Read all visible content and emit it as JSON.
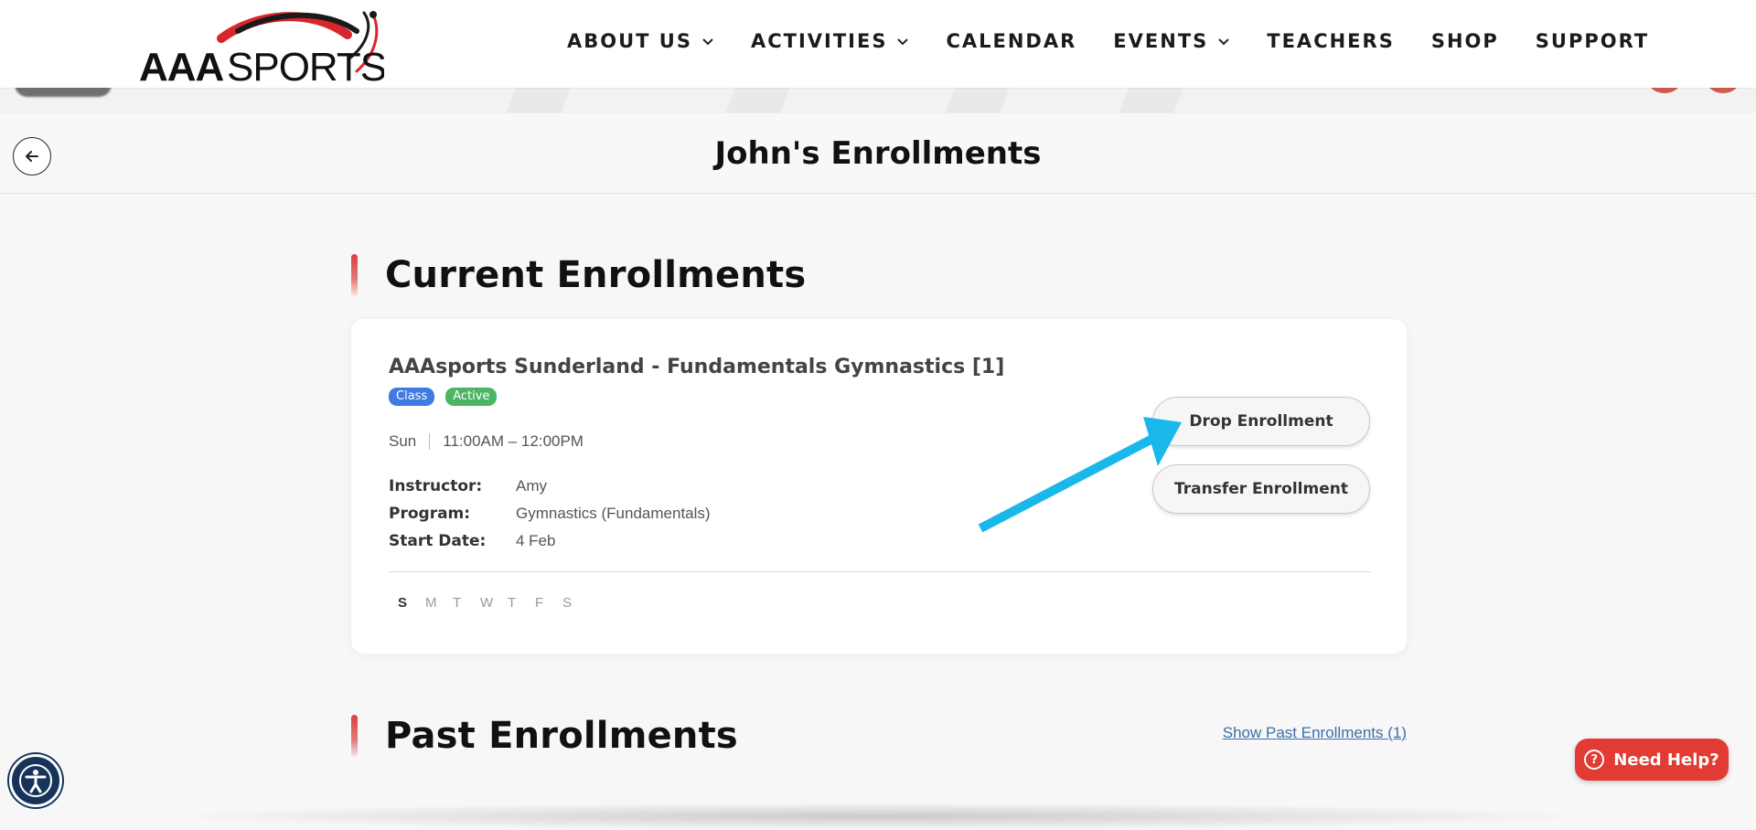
{
  "header": {
    "logo_text": "AAASPORTS",
    "logo_strong": "AAA",
    "logo_light": "SPORTS",
    "nav": [
      {
        "label": "ABOUT US",
        "has_dropdown": true
      },
      {
        "label": "ACTIVITIES",
        "has_dropdown": true
      },
      {
        "label": "CALENDAR",
        "has_dropdown": false
      },
      {
        "label": "EVENTS",
        "has_dropdown": true
      },
      {
        "label": "TEACHERS",
        "has_dropdown": false
      },
      {
        "label": "SHOP",
        "has_dropdown": false
      },
      {
        "label": "SUPPORT",
        "has_dropdown": false
      }
    ]
  },
  "page": {
    "title": "John's Enrollments",
    "back_icon": "arrow-left-icon"
  },
  "current": {
    "heading": "Current Enrollments",
    "enrollment": {
      "title": "AAAsports Sunderland - Fundamentals Gymnastics [1]",
      "badges": {
        "type": "Class",
        "status": "Active"
      },
      "day": "Sun",
      "time": "11:00AM – 12:00PM",
      "details": [
        {
          "label": "Instructor:",
          "value": "Amy"
        },
        {
          "label": "Program:",
          "value": "Gymnastics (Fundamentals)"
        },
        {
          "label": "Start Date:",
          "value": "4 Feb"
        }
      ],
      "weekdays": [
        "S",
        "M",
        "T",
        "W",
        "T",
        "F",
        "S"
      ],
      "active_weekday_index": 0,
      "drop_label": "Drop Enrollment",
      "transfer_label": "Transfer Enrollment"
    }
  },
  "past": {
    "heading": "Past Enrollments",
    "show_link": "Show Past Enrollments (1)"
  },
  "widgets": {
    "help_label": "Need Help?",
    "help_icon_glyph": "?",
    "accessibility_icon": "accessibility-icon"
  },
  "colors": {
    "brand_red": "#e13b33",
    "badge_class": "#3f7be0",
    "badge_active": "#4cb564",
    "annotation_arrow": "#1ab8ea",
    "link": "#3b6fa7",
    "a11y_bg": "#16345a"
  }
}
